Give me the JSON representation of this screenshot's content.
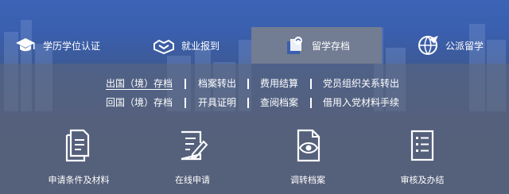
{
  "tabs": [
    {
      "label": "学历学位认证",
      "icon": "graduation-cap-icon"
    },
    {
      "label": "就业报到",
      "icon": "handshake-icon"
    },
    {
      "label": "留学存档",
      "icon": "archive-document-icon"
    },
    {
      "label": "公派留学",
      "icon": "globe-airplane-icon"
    }
  ],
  "active_tab": "留学存档",
  "links": {
    "row1": [
      "出国（境）存档",
      "档案转出",
      "费用结算",
      "党员组织关系转出"
    ],
    "row2": [
      "回国（境）存档",
      "开具证明",
      "查阅档案",
      "借用入党材料手续"
    ]
  },
  "services": [
    {
      "label": "申请条件及材料",
      "icon": "documents-icon"
    },
    {
      "label": "在线申请",
      "icon": "form-edit-icon"
    },
    {
      "label": "调转档案",
      "icon": "file-eye-icon"
    },
    {
      "label": "审核及办结",
      "icon": "checklist-icon"
    }
  ],
  "colors": {
    "accent": "#3a5fae",
    "active_tab_bg": "#727c92",
    "text": "#ffffff"
  }
}
